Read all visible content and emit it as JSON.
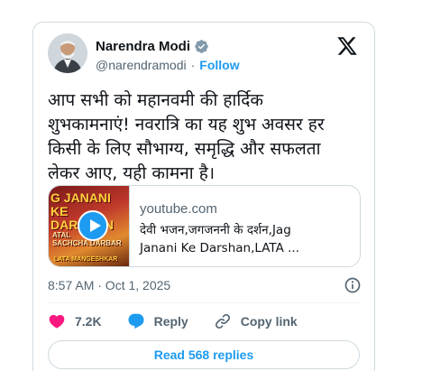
{
  "author": {
    "display_name": "Narendra Modi",
    "handle": "@narendramodi",
    "separator": "·",
    "follow_label": "Follow"
  },
  "tweet": {
    "text": "आप सभी को महानवमी की हार्दिक\nशुभकामनाएं! नवरात्रि का यह शुभ अवसर हर\nकिसी के लिए सौभाग्य, समृद्धि और सफलता\nलेकर आए, यही कामना है।",
    "timestamp": "8:57 AM · Oct 1, 2025"
  },
  "link_card": {
    "domain": "youtube.com",
    "title": "देवी भजन,जगजननी के दर्शन,Jag\nJanani Ke Darshan,LATA ...",
    "thumbnail_title": "G JANANI KE\nDARSHAN",
    "thumbnail_sub": "ATAL\nSACHCHA DARBAR",
    "thumbnail_foot": "LATA MANGESHKAR"
  },
  "actions": {
    "likes": "7.2K",
    "reply_label": "Reply",
    "copy_link_label": "Copy link"
  },
  "read_replies_label": "Read 568 replies",
  "colors": {
    "accent": "#1d9bf0",
    "like": "#f91880",
    "muted": "#536471",
    "border": "#cfd9de"
  },
  "icons": [
    "verified-badge-icon",
    "x-logo-icon",
    "play-icon",
    "info-icon",
    "heart-icon",
    "reply-bubble-icon",
    "link-icon"
  ]
}
